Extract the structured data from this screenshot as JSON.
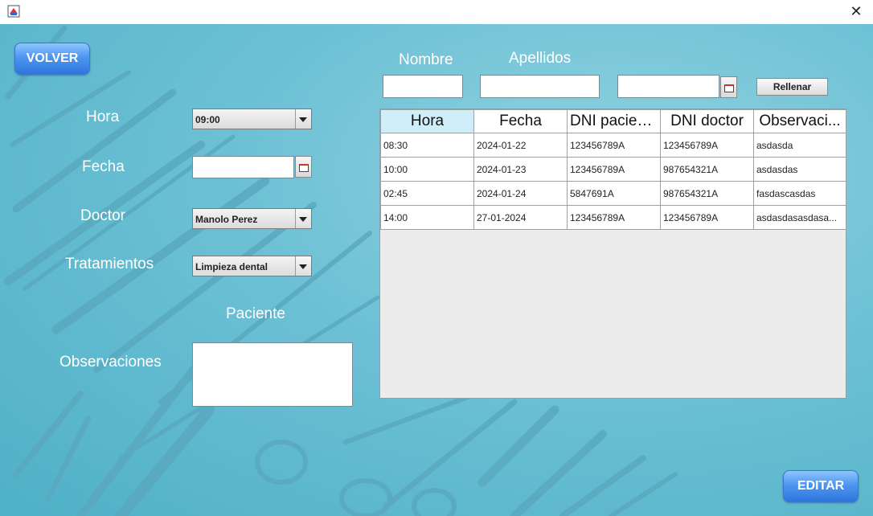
{
  "window": {
    "close_glyph": "✕",
    "icon": "java-app-icon"
  },
  "buttons": {
    "back": "VOLVER",
    "edit": "EDITAR",
    "fill": "Rellenar"
  },
  "form": {
    "hora_label": "Hora",
    "fecha_label": "Fecha",
    "doctor_label": "Doctor",
    "tratamientos_label": "Tratamientos",
    "paciente_label": "Paciente",
    "observaciones_label": "Observaciones",
    "hora_value": "09:00",
    "fecha_value": "",
    "doctor_value": "Manolo Perez",
    "tratamiento_value": "Limpieza dental",
    "observaciones_value": ""
  },
  "search": {
    "nombre_label": "Nombre",
    "apellidos_label": "Apellidos",
    "nombre_value": "",
    "apellidos_value": "",
    "fecha_value": ""
  },
  "table": {
    "headers": [
      "Hora",
      "Fecha",
      "DNI paciente",
      "DNI doctor",
      "Observaci..."
    ],
    "rows": [
      [
        "08:30",
        "2024-01-22",
        "123456789A",
        "123456789A",
        "asdasda"
      ],
      [
        "10:00",
        "2024-01-23",
        "123456789A",
        "987654321A",
        "asdasdas"
      ],
      [
        "02:45",
        "2024-01-24",
        "5847691A",
        "987654321A",
        "fasdascasdas"
      ],
      [
        "14:00",
        "27-01-2024",
        "123456789A",
        "123456789A",
        "asdasdasasdasa..."
      ]
    ]
  },
  "colors": {
    "background": "#6cc0d4",
    "accent": "#4f96f0",
    "header_selected": "#cfeefa"
  }
}
